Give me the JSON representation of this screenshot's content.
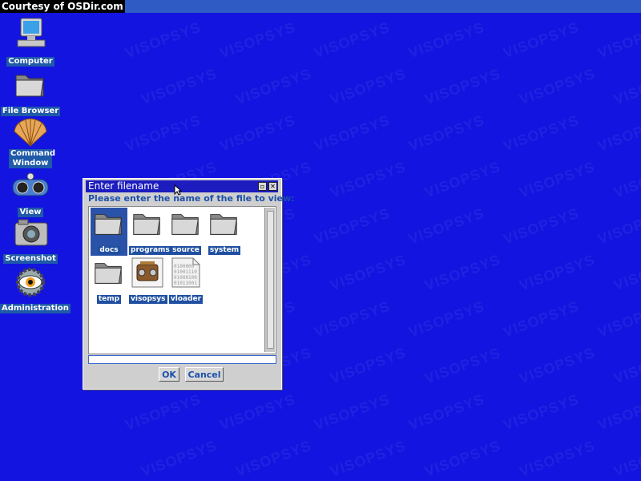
{
  "courtesy": "Courtesy of OSDir.com",
  "watermark": "VISOPSYS",
  "desktop_icons": [
    {
      "label": "Computer",
      "icon": "computer-icon"
    },
    {
      "label": "File Browser",
      "icon": "folder-icon"
    },
    {
      "label": "Command Window",
      "icon": "shell-icon"
    },
    {
      "label": "View",
      "icon": "viewer-icon"
    },
    {
      "label": "Screenshot",
      "icon": "camera-icon"
    },
    {
      "label": "Administration",
      "icon": "admin-eye-icon"
    }
  ],
  "dialog": {
    "title": "Enter filename",
    "minimize": "▫",
    "close": "✕",
    "prompt": "Please enter the name of the file to view:",
    "files": [
      {
        "label": "docs",
        "type": "folder",
        "selected": true
      },
      {
        "label": "programs",
        "type": "folder"
      },
      {
        "label": "source",
        "type": "folder"
      },
      {
        "label": "system",
        "type": "folder"
      },
      {
        "label": "temp",
        "type": "folder"
      },
      {
        "label": "visopsys",
        "type": "kernel"
      },
      {
        "label": "vloader",
        "type": "binary"
      }
    ],
    "binary_text": [
      "0100000",
      "01001110",
      "01000100",
      "01011001"
    ],
    "ok_label": "OK",
    "cancel_label": "Cancel",
    "filename_value": ""
  }
}
